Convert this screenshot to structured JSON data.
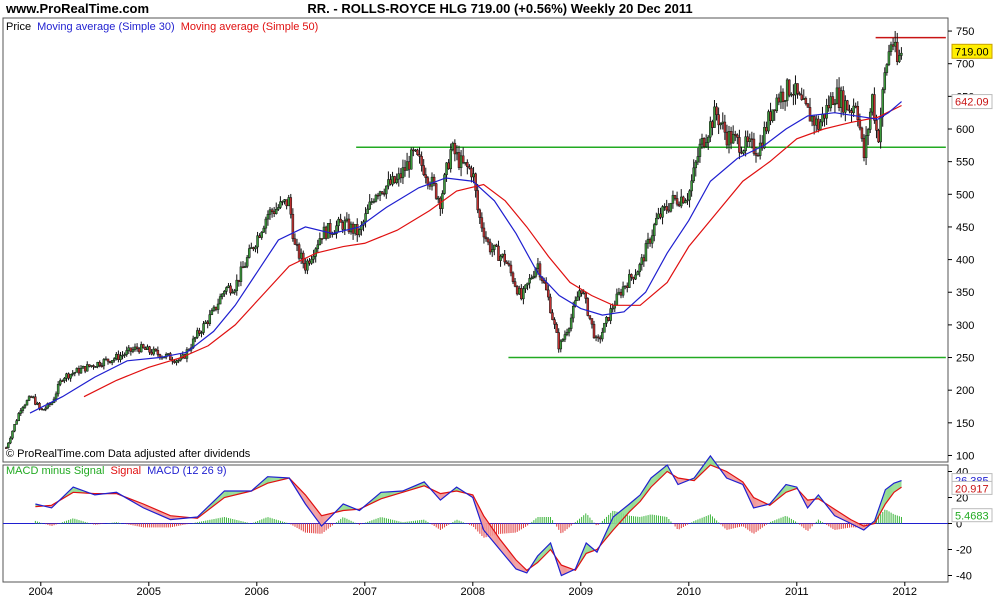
{
  "header": {
    "site": "www.ProRealTime.com",
    "title": "RR. - ROLLS-ROYCE HLG    719.00 (+0.56%)    Weekly  20 Dec 2011"
  },
  "chart_data": [
    {
      "type": "candlestick",
      "title": "RR. - ROLLS-ROYCE HLG",
      "legend": [
        {
          "label": "Price",
          "color": "#000000"
        },
        {
          "label": "Moving average (Simple 30)",
          "color": "#1f1fd0"
        },
        {
          "label": "Moving average (Simple 50)",
          "color": "#e01010"
        }
      ],
      "footnote": "© ProRealTime.com Data adjusted after dividends",
      "ylim": [
        90,
        770
      ],
      "yticks": [
        100,
        150,
        200,
        250,
        300,
        350,
        400,
        450,
        500,
        550,
        600,
        650,
        700,
        750
      ],
      "xlim": [
        2003.65,
        2012.4
      ],
      "xticks": [
        {
          "x": 2004,
          "label": "2004"
        },
        {
          "x": 2005,
          "label": "2005"
        },
        {
          "x": 2006,
          "label": "2006"
        },
        {
          "x": 2007,
          "label": "2007"
        },
        {
          "x": 2008,
          "label": "2008"
        },
        {
          "x": 2009,
          "label": "2009"
        },
        {
          "x": 2010,
          "label": "2010"
        },
        {
          "x": 2011,
          "label": "2011"
        },
        {
          "x": 2012,
          "label": "2012"
        }
      ],
      "price_path": [
        [
          2003.68,
          112
        ],
        [
          2003.82,
          175
        ],
        [
          2003.92,
          190
        ],
        [
          2004.0,
          168
        ],
        [
          2004.1,
          180
        ],
        [
          2004.2,
          220
        ],
        [
          2004.5,
          240
        ],
        [
          2004.7,
          250
        ],
        [
          2004.9,
          265
        ],
        [
          2005.1,
          255
        ],
        [
          2005.3,
          245
        ],
        [
          2005.45,
          285
        ],
        [
          2005.6,
          320
        ],
        [
          2005.7,
          355
        ],
        [
          2005.8,
          360
        ],
        [
          2005.95,
          415
        ],
        [
          2006.1,
          470
        ],
        [
          2006.3,
          490
        ],
        [
          2006.35,
          420
        ],
        [
          2006.45,
          390
        ],
        [
          2006.6,
          440
        ],
        [
          2006.8,
          455
        ],
        [
          2006.95,
          440
        ],
        [
          2007.1,
          505
        ],
        [
          2007.3,
          520
        ],
        [
          2007.45,
          560
        ],
        [
          2007.55,
          540
        ],
        [
          2007.7,
          490
        ],
        [
          2007.8,
          570
        ],
        [
          2007.9,
          545
        ],
        [
          2008.0,
          535
        ],
        [
          2008.05,
          470
        ],
        [
          2008.15,
          420
        ],
        [
          2008.3,
          400
        ],
        [
          2008.45,
          340
        ],
        [
          2008.6,
          395
        ],
        [
          2008.7,
          340
        ],
        [
          2008.8,
          265
        ],
        [
          2008.9,
          305
        ],
        [
          2009.0,
          360
        ],
        [
          2009.15,
          270
        ],
        [
          2009.3,
          330
        ],
        [
          2009.4,
          360
        ],
        [
          2009.55,
          390
        ],
        [
          2009.7,
          460
        ],
        [
          2009.85,
          490
        ],
        [
          2010.0,
          500
        ],
        [
          2010.1,
          570
        ],
        [
          2010.25,
          625
        ],
        [
          2010.35,
          590
        ],
        [
          2010.5,
          575
        ],
        [
          2010.65,
          570
        ],
        [
          2010.8,
          645
        ],
        [
          2010.95,
          665
        ],
        [
          2011.05,
          635
        ],
        [
          2011.2,
          605
        ],
        [
          2011.35,
          655
        ],
        [
          2011.5,
          630
        ],
        [
          2011.55,
          645
        ],
        [
          2011.62,
          555
        ],
        [
          2011.7,
          650
        ],
        [
          2011.75,
          580
        ],
        [
          2011.82,
          690
        ],
        [
          2011.88,
          740
        ],
        [
          2011.93,
          700
        ],
        [
          2011.97,
          719
        ]
      ],
      "ma30_path": [
        [
          2003.9,
          165
        ],
        [
          2004.2,
          190
        ],
        [
          2004.5,
          220
        ],
        [
          2004.8,
          245
        ],
        [
          2005.1,
          250
        ],
        [
          2005.35,
          258
        ],
        [
          2005.6,
          290
        ],
        [
          2005.8,
          330
        ],
        [
          2006.0,
          380
        ],
        [
          2006.2,
          430
        ],
        [
          2006.45,
          450
        ],
        [
          2006.7,
          440
        ],
        [
          2006.95,
          450
        ],
        [
          2007.2,
          480
        ],
        [
          2007.5,
          510
        ],
        [
          2007.75,
          525
        ],
        [
          2008.0,
          520
        ],
        [
          2008.2,
          490
        ],
        [
          2008.4,
          440
        ],
        [
          2008.6,
          380
        ],
        [
          2008.8,
          345
        ],
        [
          2009.0,
          325
        ],
        [
          2009.2,
          315
        ],
        [
          2009.4,
          320
        ],
        [
          2009.6,
          350
        ],
        [
          2009.8,
          410
        ],
        [
          2010.0,
          460
        ],
        [
          2010.2,
          520
        ],
        [
          2010.45,
          555
        ],
        [
          2010.7,
          575
        ],
        [
          2010.9,
          600
        ],
        [
          2011.1,
          620
        ],
        [
          2011.35,
          625
        ],
        [
          2011.55,
          620
        ],
        [
          2011.75,
          615
        ],
        [
          2011.85,
          625
        ],
        [
          2011.97,
          642
        ]
      ],
      "ma50_path": [
        [
          2004.4,
          190
        ],
        [
          2004.7,
          215
        ],
        [
          2005.0,
          235
        ],
        [
          2005.3,
          250
        ],
        [
          2005.55,
          268
        ],
        [
          2005.8,
          300
        ],
        [
          2006.05,
          345
        ],
        [
          2006.3,
          390
        ],
        [
          2006.55,
          410
        ],
        [
          2006.8,
          420
        ],
        [
          2007.0,
          425
        ],
        [
          2007.3,
          445
        ],
        [
          2007.6,
          475
        ],
        [
          2007.85,
          505
        ],
        [
          2008.1,
          515
        ],
        [
          2008.3,
          490
        ],
        [
          2008.5,
          450
        ],
        [
          2008.7,
          405
        ],
        [
          2008.9,
          365
        ],
        [
          2009.1,
          345
        ],
        [
          2009.3,
          330
        ],
        [
          2009.55,
          330
        ],
        [
          2009.8,
          365
        ],
        [
          2010.0,
          420
        ],
        [
          2010.25,
          470
        ],
        [
          2010.5,
          520
        ],
        [
          2010.75,
          550
        ],
        [
          2011.0,
          585
        ],
        [
          2011.25,
          600
        ],
        [
          2011.5,
          610
        ],
        [
          2011.75,
          618
        ],
        [
          2011.97,
          636
        ]
      ],
      "support_lines": [
        {
          "x": [
            2006.92,
            2012.38
          ],
          "y": 572,
          "color": "#22aa22"
        },
        {
          "x": [
            2008.33,
            2012.38
          ],
          "y": 250,
          "color": "#22aa22"
        },
        {
          "x": [
            2011.73,
            2012.38
          ],
          "y": 740,
          "color": "#c81414"
        }
      ],
      "value_tags": [
        {
          "value": "719.00",
          "y": 719,
          "bg": "#ffee00",
          "fg": "#000000"
        },
        {
          "value": "642.09",
          "y": 642,
          "bg": "#ffffff",
          "fg": "#c81414"
        }
      ]
    },
    {
      "type": "macd",
      "legend": [
        {
          "label": "MACD minus Signal",
          "color": "#22aa22"
        },
        {
          "label": "Signal",
          "color": "#e01010"
        },
        {
          "label": "MACD (12 26 9)",
          "color": "#1f1fd0"
        }
      ],
      "ylim": [
        -45,
        45
      ],
      "yticks": [
        40,
        20,
        0,
        -20,
        -40
      ],
      "macd_path": [
        [
          2003.95,
          15
        ],
        [
          2004.1,
          12
        ],
        [
          2004.3,
          28
        ],
        [
          2004.5,
          22
        ],
        [
          2004.7,
          24
        ],
        [
          2004.95,
          12
        ],
        [
          2005.2,
          3
        ],
        [
          2005.45,
          5
        ],
        [
          2005.7,
          25
        ],
        [
          2005.95,
          25
        ],
        [
          2006.1,
          36
        ],
        [
          2006.3,
          35
        ],
        [
          2006.45,
          15
        ],
        [
          2006.6,
          -2
        ],
        [
          2006.8,
          15
        ],
        [
          2006.95,
          10
        ],
        [
          2007.15,
          24
        ],
        [
          2007.35,
          25
        ],
        [
          2007.55,
          32
        ],
        [
          2007.7,
          18
        ],
        [
          2007.85,
          28
        ],
        [
          2008.0,
          20
        ],
        [
          2008.1,
          -5
        ],
        [
          2008.25,
          -20
        ],
        [
          2008.4,
          -35
        ],
        [
          2008.5,
          -38
        ],
        [
          2008.6,
          -25
        ],
        [
          2008.72,
          -15
        ],
        [
          2008.82,
          -40
        ],
        [
          2008.95,
          -35
        ],
        [
          2009.05,
          -15
        ],
        [
          2009.15,
          -22
        ],
        [
          2009.3,
          5
        ],
        [
          2009.45,
          15
        ],
        [
          2009.55,
          22
        ],
        [
          2009.65,
          35
        ],
        [
          2009.8,
          45
        ],
        [
          2009.9,
          30
        ],
        [
          2010.05,
          35
        ],
        [
          2010.2,
          52
        ],
        [
          2010.35,
          35
        ],
        [
          2010.5,
          30
        ],
        [
          2010.6,
          12
        ],
        [
          2010.75,
          15
        ],
        [
          2010.9,
          30
        ],
        [
          2011.0,
          28
        ],
        [
          2011.1,
          12
        ],
        [
          2011.2,
          22
        ],
        [
          2011.35,
          6
        ],
        [
          2011.5,
          0
        ],
        [
          2011.62,
          -5
        ],
        [
          2011.72,
          2
        ],
        [
          2011.82,
          26
        ],
        [
          2011.9,
          31
        ],
        [
          2011.97,
          33
        ]
      ],
      "signal_path": [
        [
          2003.95,
          13
        ],
        [
          2004.1,
          14
        ],
        [
          2004.3,
          24
        ],
        [
          2004.5,
          23
        ],
        [
          2004.7,
          23
        ],
        [
          2004.95,
          15
        ],
        [
          2005.2,
          6
        ],
        [
          2005.45,
          4
        ],
        [
          2005.7,
          20
        ],
        [
          2005.95,
          25
        ],
        [
          2006.1,
          31
        ],
        [
          2006.3,
          35
        ],
        [
          2006.45,
          22
        ],
        [
          2006.6,
          6
        ],
        [
          2006.8,
          10
        ],
        [
          2006.95,
          11
        ],
        [
          2007.15,
          19
        ],
        [
          2007.35,
          24
        ],
        [
          2007.55,
          29
        ],
        [
          2007.7,
          23
        ],
        [
          2007.85,
          25
        ],
        [
          2008.0,
          22
        ],
        [
          2008.1,
          6
        ],
        [
          2008.25,
          -12
        ],
        [
          2008.4,
          -28
        ],
        [
          2008.5,
          -36
        ],
        [
          2008.6,
          -30
        ],
        [
          2008.72,
          -20
        ],
        [
          2008.82,
          -32
        ],
        [
          2008.95,
          -36
        ],
        [
          2009.05,
          -23
        ],
        [
          2009.15,
          -20
        ],
        [
          2009.3,
          -5
        ],
        [
          2009.45,
          9
        ],
        [
          2009.55,
          17
        ],
        [
          2009.65,
          28
        ],
        [
          2009.8,
          40
        ],
        [
          2009.9,
          35
        ],
        [
          2010.05,
          33
        ],
        [
          2010.2,
          45
        ],
        [
          2010.35,
          40
        ],
        [
          2010.5,
          32
        ],
        [
          2010.6,
          20
        ],
        [
          2010.75,
          14
        ],
        [
          2010.9,
          24
        ],
        [
          2011.0,
          27
        ],
        [
          2011.1,
          18
        ],
        [
          2011.2,
          19
        ],
        [
          2011.35,
          11
        ],
        [
          2011.5,
          3
        ],
        [
          2011.62,
          -2
        ],
        [
          2011.72,
          0
        ],
        [
          2011.82,
          15
        ],
        [
          2011.9,
          24
        ],
        [
          2011.97,
          28
        ]
      ],
      "value_tags": [
        {
          "value": "26.385",
          "y": 33,
          "fg": "#1f1fd0"
        },
        {
          "value": "20.917",
          "y": 27,
          "fg": "#c81414"
        },
        {
          "value": "5.4683",
          "y": 6,
          "fg": "#22aa22"
        }
      ]
    }
  ]
}
